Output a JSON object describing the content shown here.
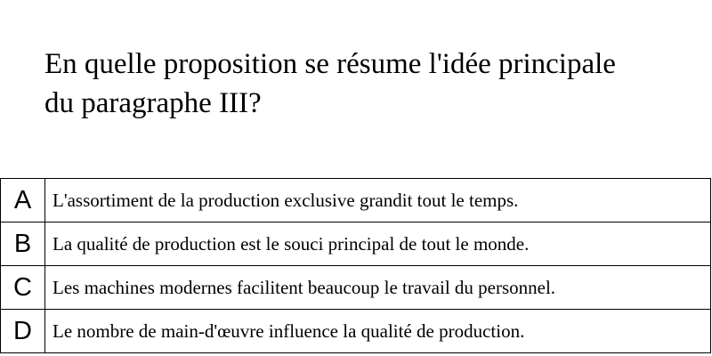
{
  "question": {
    "line1": "En quelle proposition se résume l'idée principale",
    "line2": "du paragraphe III?"
  },
  "options": [
    {
      "letter": "A",
      "text": "L'assortiment de la production exclusive grandit tout le temps."
    },
    {
      "letter": "B",
      "text": "La qualité de production est le souci principal de tout le monde."
    },
    {
      "letter": "C",
      "text": "Les machines modernes facilitent beaucoup le travail du personnel."
    },
    {
      "letter": "D",
      "text": "Le nombre de main-d'œuvre influence la qualité de production."
    }
  ]
}
